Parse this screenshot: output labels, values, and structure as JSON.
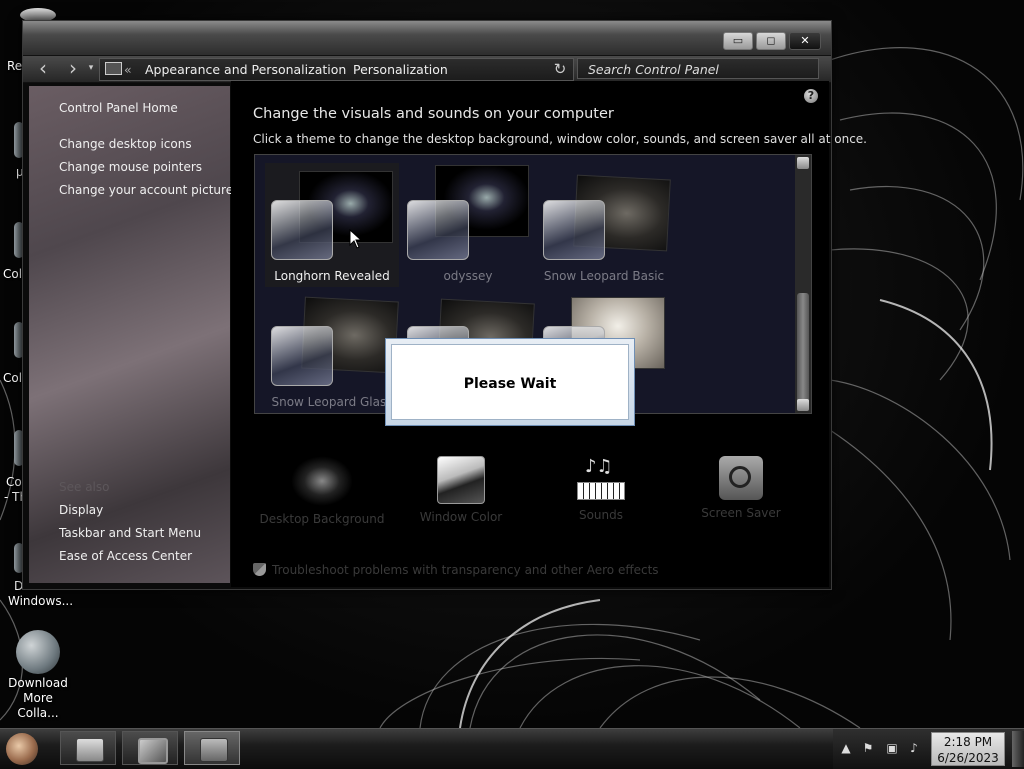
{
  "window": {
    "title_buttons": {
      "minimize": "▭",
      "maximize": "◻",
      "close": "✕"
    },
    "breadcrumb": {
      "chevron": "«",
      "items": [
        "Appearance and Personalization",
        "Personalization"
      ]
    },
    "search_placeholder": "Search Control Panel"
  },
  "sidebar": {
    "home": "Control Panel Home",
    "tasks": [
      "Change desktop icons",
      "Change mouse pointers",
      "Change your account picture"
    ],
    "see_also_heading": "See also",
    "see_also": [
      "Display",
      "Taskbar and Start Menu",
      "Ease of Access Center"
    ]
  },
  "main": {
    "title": "Change the visuals and sounds on your computer",
    "description": "Click a theme to change the desktop background, window color, sounds, and screen saver all at once.",
    "help": "?",
    "themes": [
      {
        "name": "Longhorn Revealed",
        "selected": true
      },
      {
        "name": "odyssey",
        "selected": false
      },
      {
        "name": "Snow Leopard Basic",
        "selected": false
      },
      {
        "name": "Snow Leopard Glass",
        "selected": false
      },
      {
        "name": "",
        "selected": false
      },
      {
        "name": "",
        "selected": false
      }
    ],
    "settings": [
      "Desktop Background",
      "Window Color",
      "Sounds",
      "Screen Saver"
    ],
    "troubleshoot": "Troubleshoot problems with transparency and other Aero effects"
  },
  "dialog": {
    "text": "Please Wait"
  },
  "desktop_icons": {
    "recycle_partial": "Re",
    "col1": "Col",
    "col2": "Col",
    "co_th_1": "Co",
    "co_th_2": "- Th",
    "d_letter": "D",
    "windows_label": "Windows...",
    "download_label": "Download More Colla..."
  },
  "taskbar": {
    "clock_time": "2:18 PM",
    "clock_date": "6/26/2023"
  },
  "colors": {
    "accent": "#6f8fb5",
    "desktop": "#000000",
    "sidebar": "#5d545a"
  }
}
